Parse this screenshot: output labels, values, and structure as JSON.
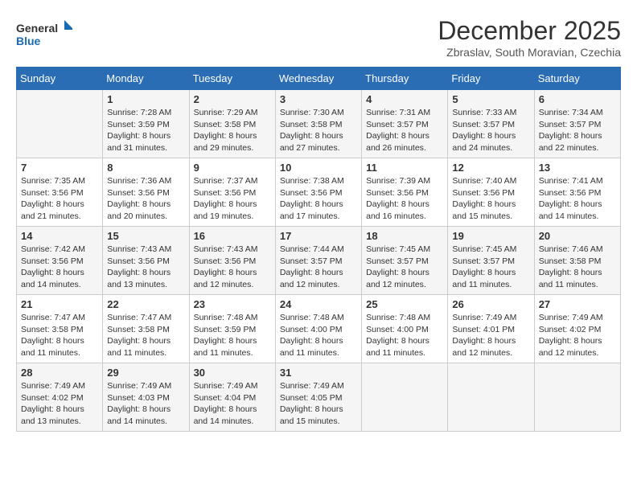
{
  "logo": {
    "line1": "General",
    "line2": "Blue"
  },
  "title": "December 2025",
  "subtitle": "Zbraslav, South Moravian, Czechia",
  "days_header": [
    "Sunday",
    "Monday",
    "Tuesday",
    "Wednesday",
    "Thursday",
    "Friday",
    "Saturday"
  ],
  "weeks": [
    [
      {
        "day": "",
        "info": ""
      },
      {
        "day": "1",
        "info": "Sunrise: 7:28 AM\nSunset: 3:59 PM\nDaylight: 8 hours\nand 31 minutes."
      },
      {
        "day": "2",
        "info": "Sunrise: 7:29 AM\nSunset: 3:58 PM\nDaylight: 8 hours\nand 29 minutes."
      },
      {
        "day": "3",
        "info": "Sunrise: 7:30 AM\nSunset: 3:58 PM\nDaylight: 8 hours\nand 27 minutes."
      },
      {
        "day": "4",
        "info": "Sunrise: 7:31 AM\nSunset: 3:57 PM\nDaylight: 8 hours\nand 26 minutes."
      },
      {
        "day": "5",
        "info": "Sunrise: 7:33 AM\nSunset: 3:57 PM\nDaylight: 8 hours\nand 24 minutes."
      },
      {
        "day": "6",
        "info": "Sunrise: 7:34 AM\nSunset: 3:57 PM\nDaylight: 8 hours\nand 22 minutes."
      }
    ],
    [
      {
        "day": "7",
        "info": "Sunrise: 7:35 AM\nSunset: 3:56 PM\nDaylight: 8 hours\nand 21 minutes."
      },
      {
        "day": "8",
        "info": "Sunrise: 7:36 AM\nSunset: 3:56 PM\nDaylight: 8 hours\nand 20 minutes."
      },
      {
        "day": "9",
        "info": "Sunrise: 7:37 AM\nSunset: 3:56 PM\nDaylight: 8 hours\nand 19 minutes."
      },
      {
        "day": "10",
        "info": "Sunrise: 7:38 AM\nSunset: 3:56 PM\nDaylight: 8 hours\nand 17 minutes."
      },
      {
        "day": "11",
        "info": "Sunrise: 7:39 AM\nSunset: 3:56 PM\nDaylight: 8 hours\nand 16 minutes."
      },
      {
        "day": "12",
        "info": "Sunrise: 7:40 AM\nSunset: 3:56 PM\nDaylight: 8 hours\nand 15 minutes."
      },
      {
        "day": "13",
        "info": "Sunrise: 7:41 AM\nSunset: 3:56 PM\nDaylight: 8 hours\nand 14 minutes."
      }
    ],
    [
      {
        "day": "14",
        "info": "Sunrise: 7:42 AM\nSunset: 3:56 PM\nDaylight: 8 hours\nand 14 minutes."
      },
      {
        "day": "15",
        "info": "Sunrise: 7:43 AM\nSunset: 3:56 PM\nDaylight: 8 hours\nand 13 minutes."
      },
      {
        "day": "16",
        "info": "Sunrise: 7:43 AM\nSunset: 3:56 PM\nDaylight: 8 hours\nand 12 minutes."
      },
      {
        "day": "17",
        "info": "Sunrise: 7:44 AM\nSunset: 3:57 PM\nDaylight: 8 hours\nand 12 minutes."
      },
      {
        "day": "18",
        "info": "Sunrise: 7:45 AM\nSunset: 3:57 PM\nDaylight: 8 hours\nand 12 minutes."
      },
      {
        "day": "19",
        "info": "Sunrise: 7:45 AM\nSunset: 3:57 PM\nDaylight: 8 hours\nand 11 minutes."
      },
      {
        "day": "20",
        "info": "Sunrise: 7:46 AM\nSunset: 3:58 PM\nDaylight: 8 hours\nand 11 minutes."
      }
    ],
    [
      {
        "day": "21",
        "info": "Sunrise: 7:47 AM\nSunset: 3:58 PM\nDaylight: 8 hours\nand 11 minutes."
      },
      {
        "day": "22",
        "info": "Sunrise: 7:47 AM\nSunset: 3:58 PM\nDaylight: 8 hours\nand 11 minutes."
      },
      {
        "day": "23",
        "info": "Sunrise: 7:48 AM\nSunset: 3:59 PM\nDaylight: 8 hours\nand 11 minutes."
      },
      {
        "day": "24",
        "info": "Sunrise: 7:48 AM\nSunset: 4:00 PM\nDaylight: 8 hours\nand 11 minutes."
      },
      {
        "day": "25",
        "info": "Sunrise: 7:48 AM\nSunset: 4:00 PM\nDaylight: 8 hours\nand 11 minutes."
      },
      {
        "day": "26",
        "info": "Sunrise: 7:49 AM\nSunset: 4:01 PM\nDaylight: 8 hours\nand 12 minutes."
      },
      {
        "day": "27",
        "info": "Sunrise: 7:49 AM\nSunset: 4:02 PM\nDaylight: 8 hours\nand 12 minutes."
      }
    ],
    [
      {
        "day": "28",
        "info": "Sunrise: 7:49 AM\nSunset: 4:02 PM\nDaylight: 8 hours\nand 13 minutes."
      },
      {
        "day": "29",
        "info": "Sunrise: 7:49 AM\nSunset: 4:03 PM\nDaylight: 8 hours\nand 14 minutes."
      },
      {
        "day": "30",
        "info": "Sunrise: 7:49 AM\nSunset: 4:04 PM\nDaylight: 8 hours\nand 14 minutes."
      },
      {
        "day": "31",
        "info": "Sunrise: 7:49 AM\nSunset: 4:05 PM\nDaylight: 8 hours\nand 15 minutes."
      },
      {
        "day": "",
        "info": ""
      },
      {
        "day": "",
        "info": ""
      },
      {
        "day": "",
        "info": ""
      }
    ]
  ]
}
